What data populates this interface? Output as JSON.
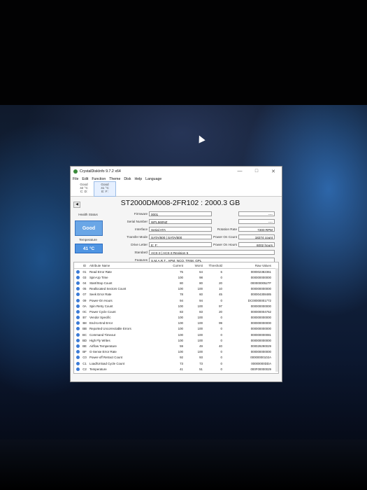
{
  "window": {
    "title": "CrystalDiskInfo 9.7.2 x64"
  },
  "menu": [
    "File",
    "Edit",
    "Function",
    "Theme",
    "Disk",
    "Help",
    "Language"
  ],
  "drives": [
    {
      "status": "Good",
      "temp": "42 °C",
      "letter": "C: D:"
    },
    {
      "status": "Good",
      "temp": "41 °C",
      "letter": "E: F:"
    }
  ],
  "disk": {
    "model": "ST2000DM008-2FR102 : 2000.3 GB",
    "firmware_label": "Firmware",
    "firmware": "0001",
    "serial_label": "Serial Number",
    "serial": "WFL560NZ",
    "interface_label": "Interface",
    "interface": "Serial ATA",
    "transfer_label": "Transfer Mode",
    "transfer": "SATA/600 | SATA/600",
    "driveletter_label": "Drive Letter",
    "driveletter": "E: F:",
    "standard_label": "Standard",
    "standard": "ACS-3 | ACS-3 Revision 5",
    "features_label": "Features",
    "features": "S.M.A.R.T., APM, NCQ, TRIM, GPL",
    "rotation_label": "Rotation Rate",
    "rotation": "7200 RPM",
    "poweron_count_label": "Power On Count",
    "poweron_count": "18274 count",
    "poweron_hours_label": "Power On Hours",
    "poweron_hours": "6002 hours",
    "blank1": "----",
    "blank2": "----"
  },
  "health": {
    "label": "Health Status",
    "value": "Good"
  },
  "temperature": {
    "label": "Temperature",
    "value": "41 °C"
  },
  "smart_headers": {
    "id": "ID",
    "name": "Attribute Name",
    "current": "Current",
    "worst": "Worst",
    "threshold": "Threshold",
    "raw": "Raw Values"
  },
  "smart": [
    {
      "id": "01",
      "name": "Read Error Rate",
      "current": "75",
      "worst": "64",
      "threshold": "6",
      "raw": "000002382361"
    },
    {
      "id": "03",
      "name": "Spin-Up Time",
      "current": "100",
      "worst": "98",
      "threshold": "0",
      "raw": "000000000000"
    },
    {
      "id": "04",
      "name": "Start/Stop Count",
      "current": "80",
      "worst": "80",
      "threshold": "20",
      "raw": "00000000527F"
    },
    {
      "id": "05",
      "name": "Reallocated Sectors Count",
      "current": "100",
      "worst": "100",
      "threshold": "10",
      "raw": "000000000000"
    },
    {
      "id": "07",
      "name": "Seek Error Rate",
      "current": "78",
      "worst": "60",
      "threshold": "45",
      "raw": "000004308485"
    },
    {
      "id": "09",
      "name": "Power-On Hours",
      "current": "94",
      "worst": "94",
      "threshold": "0",
      "raw": "DC00000001772"
    },
    {
      "id": "0A",
      "name": "Spin Retry Count",
      "current": "100",
      "worst": "100",
      "threshold": "97",
      "raw": "000000000000"
    },
    {
      "id": "0C",
      "name": "Power Cycle Count",
      "current": "83",
      "worst": "83",
      "threshold": "20",
      "raw": "000000004762"
    },
    {
      "id": "B7",
      "name": "Vendor Specific",
      "current": "100",
      "worst": "100",
      "threshold": "0",
      "raw": "000000000000"
    },
    {
      "id": "B8",
      "name": "End-to-End Error",
      "current": "100",
      "worst": "100",
      "threshold": "99",
      "raw": "000000000000"
    },
    {
      "id": "BB",
      "name": "Reported Uncorrectable Errors",
      "current": "100",
      "worst": "100",
      "threshold": "0",
      "raw": "000000000000"
    },
    {
      "id": "BC",
      "name": "Command Timeout",
      "current": "100",
      "worst": "100",
      "threshold": "0",
      "raw": "000000000081"
    },
    {
      "id": "BD",
      "name": "High Fly Writes",
      "current": "100",
      "worst": "100",
      "threshold": "0",
      "raw": "000000000000"
    },
    {
      "id": "BE",
      "name": "Airflow Temperature",
      "current": "59",
      "worst": "49",
      "threshold": "40",
      "raw": "000029290029"
    },
    {
      "id": "BF",
      "name": "G-Sense Error Rate",
      "current": "100",
      "worst": "100",
      "threshold": "0",
      "raw": "000000000000"
    },
    {
      "id": "C0",
      "name": "Power-off Retract Count",
      "current": "92",
      "worst": "93",
      "threshold": "0",
      "raw": "00000000102A"
    },
    {
      "id": "C1",
      "name": "Load/Unload Cycle Count",
      "current": "73",
      "worst": "73",
      "threshold": "0",
      "raw": "00000000DDA"
    },
    {
      "id": "C2",
      "name": "Temperature",
      "current": "41",
      "worst": "51",
      "threshold": "0",
      "raw": "000F00000029"
    }
  ]
}
